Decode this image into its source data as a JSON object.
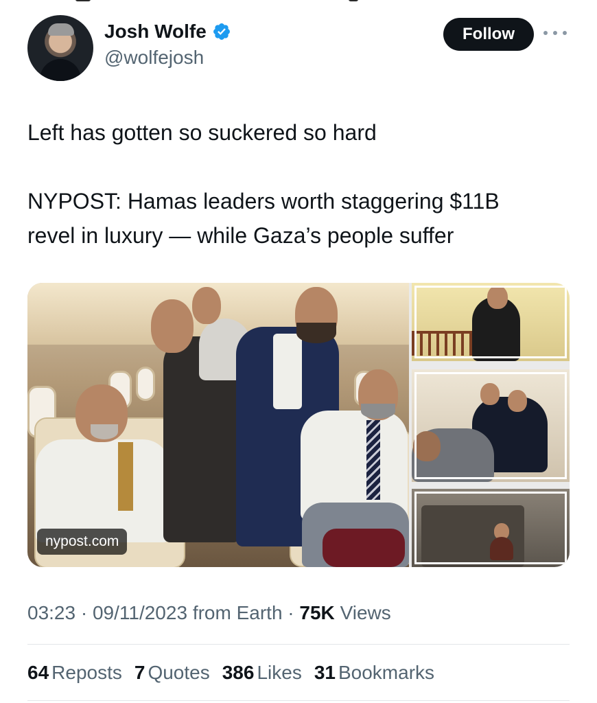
{
  "author": {
    "display_name": "Josh Wolfe",
    "handle": "@wolfejosh",
    "verified": true
  },
  "actions": {
    "follow_label": "Follow"
  },
  "tweet": {
    "line1": "Left has gotten so suckered so hard",
    "line2": "NYPOST: Hamas leaders worth staggering $11B",
    "line3": "revel in luxury — while Gaza’s people suffer"
  },
  "media": {
    "source_label": "nypost.com"
  },
  "meta": {
    "time": "03:23",
    "separator": "·",
    "date": "09/11/2023",
    "client": "from Earth",
    "views_count": "75K",
    "views_label": "Views"
  },
  "stats": {
    "reposts_count": "64",
    "reposts_label": "Reposts",
    "quotes_count": "7",
    "quotes_label": "Quotes",
    "likes_count": "386",
    "likes_label": "Likes",
    "bookmarks_count": "31",
    "bookmarks_label": "Bookmarks"
  },
  "colors": {
    "verified_blue": "#1d9bf0",
    "text_primary": "#0f1419",
    "text_secondary": "#536471",
    "button_bg": "#0f1419"
  }
}
